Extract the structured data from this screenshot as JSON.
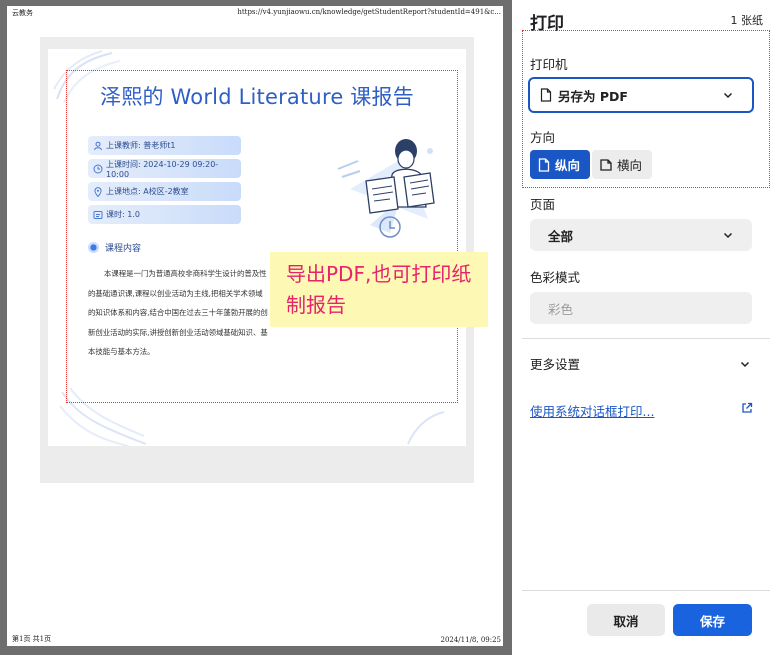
{
  "preview": {
    "header_left": "云教务",
    "header_right": "https://v4.yunjiaowu.cn/knowledge/getStudentReport?studentId=491&c...",
    "footer_left": "第1页 共1页",
    "footer_right": "2024/11/8, 09:25",
    "report": {
      "title": "泽熙的 World Literature 课报告",
      "info": [
        {
          "icon": "teacher-icon",
          "text": "上课教师:  普老师t1"
        },
        {
          "icon": "clock-icon",
          "text": "上课时间:  2024-10-29 09:20-10:00"
        },
        {
          "icon": "location-icon",
          "text": "上课地点:  A校区-2教室"
        },
        {
          "icon": "hours-icon",
          "text": "课时:  1.0"
        }
      ],
      "section_title": "课程内容",
      "section_body": "本课程是一门为普通高校非商科学生设计的普及性的基础通识课,课程以创业活动为主线,把相关学术领域的知识体系和内容,结合中国在过去三十年蓬勃开展的创新创业活动的实际,讲授创新创业活动领域基础知识、基本技能与基本方法。"
    },
    "annotation_note": "导出PDF,也可打印纸制报告"
  },
  "panel": {
    "title": "打印",
    "sheet_count": "1 张纸",
    "printer_label": "打印机",
    "printer_value": "另存为 PDF",
    "orientation_label": "方向",
    "orientation_portrait": "纵向",
    "orientation_landscape": "横向",
    "pages_label": "页面",
    "pages_value": "全部",
    "color_label": "色彩模式",
    "color_value": "彩色",
    "more_settings": "更多设置",
    "system_dialog_link": "使用系统对话框打印...",
    "cancel_label": "取消",
    "save_label": "保存"
  },
  "colors": {
    "accent": "#1a56c4",
    "save_button": "#1a63df",
    "report_title": "#2f5fc6",
    "annotation_border": "#ee3333",
    "note_background": "#fdf8b4",
    "note_text": "#e6236b"
  }
}
